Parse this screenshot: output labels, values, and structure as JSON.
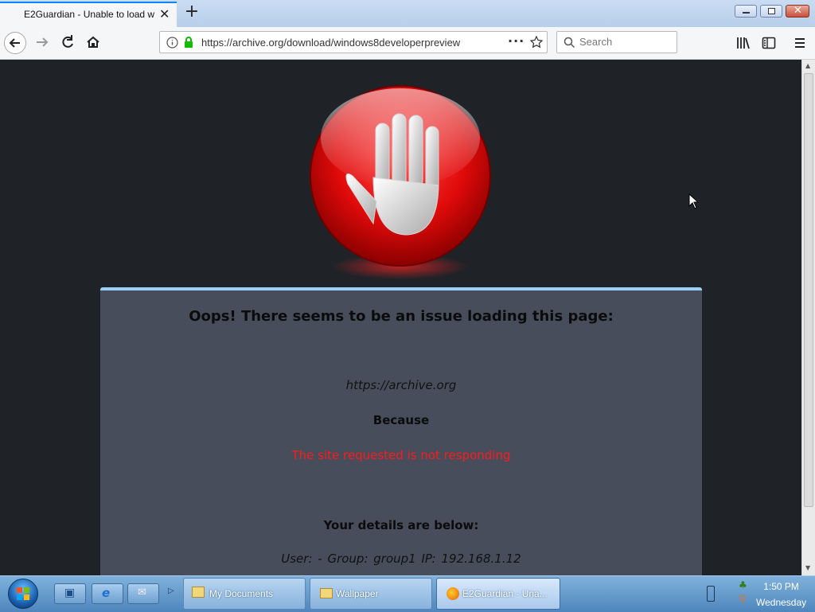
{
  "browser": {
    "tab": {
      "title": "E2Guardian - Unable to load w"
    },
    "url": "https://archive.org/download/windows8developerpreview",
    "search": {
      "placeholder": "Search"
    }
  },
  "page": {
    "heading": "Oops! There seems to be an issue loading this page:",
    "blocked_url": "https://archive.org",
    "because": "Because",
    "reason": "The site requested is not responding",
    "details_heading": "Your details are below:",
    "details": "User: -   Group: group1   IP: 192.168.1.12"
  },
  "taskbar": {
    "buttons": [
      {
        "label": "My Documents",
        "icon": "folder-icon"
      },
      {
        "label": "Wallpaper",
        "icon": "folder-icon"
      },
      {
        "label": "E2Guardian - Una...",
        "icon": "firefox-icon"
      }
    ],
    "clock": {
      "time": "1:50 PM",
      "day": "Wednesday"
    }
  },
  "colors": {
    "page_background": "#1f2328",
    "panel_background": "#474d5b",
    "panel_accent": "#9ad0f5",
    "error_text": "#ff1a1a"
  }
}
